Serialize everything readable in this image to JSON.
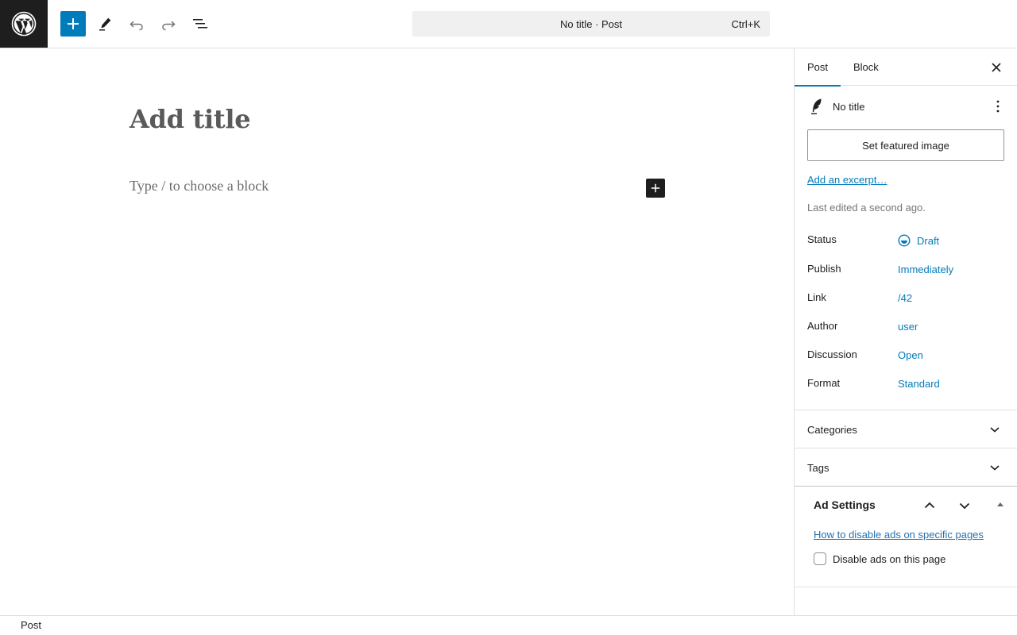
{
  "header": {
    "logo_icon": "wordpress-logo-icon",
    "add_block_icon": "plus-icon",
    "tools_icon": "pencil-icon",
    "undo_icon": "undo-icon",
    "redo_icon": "redo-icon",
    "outline_icon": "list-view-icon",
    "command_bar_label": "No title · Post",
    "command_shortcut": "Ctrl+K",
    "accent_color": "#007cba"
  },
  "editor": {
    "title_placeholder": "Add title",
    "block_placeholder": "Type / to choose a block"
  },
  "sidebar": {
    "tabs": [
      {
        "label": "Post"
      },
      {
        "label": "Block"
      }
    ],
    "post_name": "No title",
    "featured_image_label": "Set featured image",
    "excerpt_link": "Add an excerpt…",
    "last_edited": "Last edited a second ago.",
    "meta": [
      {
        "label": "Status",
        "value": "Draft"
      },
      {
        "label": "Publish",
        "value": "Immediately"
      },
      {
        "label": "Link",
        "value": "/42"
      },
      {
        "label": "Author",
        "value": "user"
      },
      {
        "label": "Discussion",
        "value": "Open"
      },
      {
        "label": "Format",
        "value": "Standard"
      }
    ],
    "panels": [
      {
        "title": "Categories"
      },
      {
        "title": "Tags"
      }
    ],
    "ad_settings": {
      "title": "Ad Settings",
      "help_link": "How to disable ads on specific pages",
      "checkbox_label": "Disable ads on this page",
      "checkbox_checked": false
    }
  },
  "footer": {
    "breadcrumb": "Post"
  }
}
